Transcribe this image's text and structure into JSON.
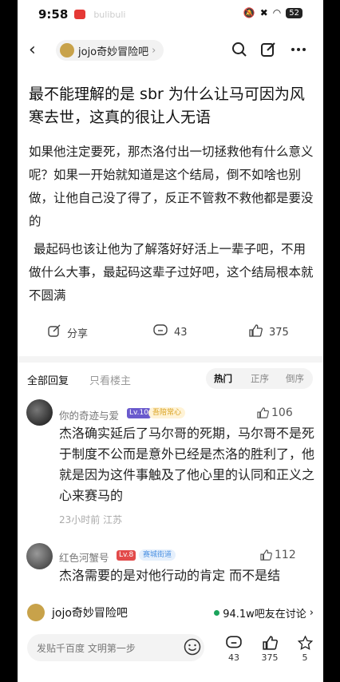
{
  "status": {
    "time": "9:58",
    "faint_text": "bulibuli",
    "battery": "52"
  },
  "nav": {
    "forum_name": "jojo奇妙冒险吧",
    "chevron": "›"
  },
  "post": {
    "title": "最不能理解的是 sbr 为什么让马可因为风寒去世，这真的很让人无语",
    "paragraph1": "如果他注定要死，那杰洛付出一切拯救他有什么意义呢？如果一开始就知道是这个结局，倒不如啥也别做，让他自己没了得了，反正不管救不救他都是要没的",
    "paragraph2": "最起码也该让他为了解落好好活上一辈子吧，不用做什么大事，最起码这辈子过好吧，这个结局根本就不圆满"
  },
  "actions": {
    "share_label": "分享",
    "comments": "43",
    "likes": "375"
  },
  "tabs": {
    "all": "全部回复",
    "op_only": "只看楼主",
    "hot": "热门",
    "asc": "正序",
    "desc": "倒序"
  },
  "comments": [
    {
      "user": "你的奇迹与爱",
      "level": "Lv.10",
      "badge": "吾陪常心",
      "likes": "106",
      "text": "杰洛确实延后了马尔哥的死期，马尔哥不是死于制度不公而是意外已经是杰洛的胜利了，他就是因为这件事触及了他心里的认同和正义之心来赛马的",
      "meta": "23小时前  江苏"
    },
    {
      "user": "红色河蟹号",
      "level": "Lv.8",
      "badge": "赛城街道",
      "likes": "112",
      "text": "杰洛需要的是对他行动的肯定 而不是结"
    }
  ],
  "bottom": {
    "forum_name": "jojo奇妙冒险吧",
    "online": "94.1w吧友在讨论",
    "input_placeholder": "发贴千百度 文明第一步",
    "comment_count": "43",
    "like_count": "375",
    "star_count": "5"
  },
  "colors": {
    "accent_green": "#1aa35b",
    "level_purple": "#6a5acd",
    "level_red": "#e24a4a",
    "badge_gold": "#d9a01e",
    "badge_blue": "#4a90e2"
  }
}
